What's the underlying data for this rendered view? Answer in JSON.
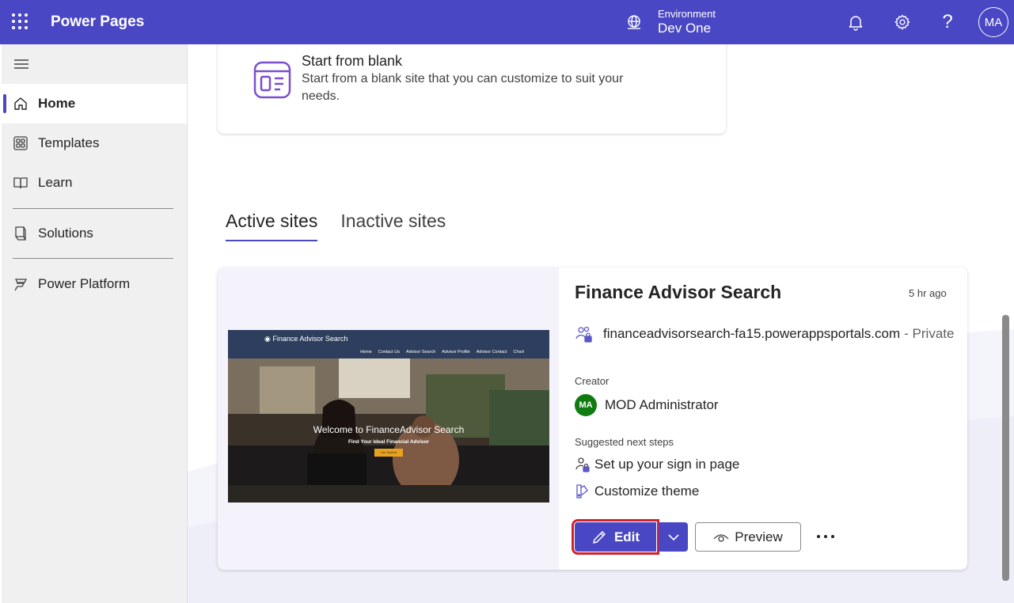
{
  "header": {
    "app_name": "Power Pages",
    "environment_label": "Environment",
    "environment_name": "Dev One",
    "help_glyph": "?",
    "user_initials": "MA",
    "icons": [
      "waffle-icon",
      "globe-icon",
      "bell-icon",
      "gear-icon",
      "help-icon"
    ]
  },
  "sidebar": {
    "items": [
      {
        "label": "Home",
        "icon": "home-icon",
        "active": true
      },
      {
        "label": "Templates",
        "icon": "templates-icon",
        "active": false
      },
      {
        "label": "Learn",
        "icon": "book-icon",
        "active": false
      },
      {
        "label": "Solutions",
        "icon": "solutions-icon",
        "active": false
      },
      {
        "label": "Power Platform",
        "icon": "power-platform-icon",
        "active": false
      }
    ]
  },
  "blank_card": {
    "title": "Start from blank",
    "description": "Start from a blank site that you can customize to suit your needs."
  },
  "tabs": [
    {
      "label": "Active sites",
      "active": true
    },
    {
      "label": "Inactive sites",
      "active": false
    }
  ],
  "site": {
    "name": "Finance Advisor Search",
    "time": "5 hr ago",
    "url": "financeadvisorsearch-fa15.powerappsportals.com",
    "visibility": "- Private",
    "creator_label": "Creator",
    "creator_initials": "MA",
    "creator_name": "MOD Administrator",
    "next_steps_label": "Suggested next steps",
    "steps": [
      "Set up your sign in page",
      "Customize theme"
    ],
    "thumbnail": {
      "title": "Finance Advisor Search",
      "nav": [
        "Home",
        "Contact Us",
        "Advisor Search",
        "Advisor Profile",
        "Advisor Contact",
        "Chart"
      ],
      "welcome": "Welcome to FinanceAdvisor Search",
      "subtitle": "Find Your Ideal Financial Advisor",
      "cta": "Get Started"
    }
  },
  "actions": {
    "edit": "Edit",
    "preview": "Preview"
  },
  "colors": {
    "brand": "#4a47c4",
    "highlight": "#d2222d",
    "creator_avatar": "#107c10"
  }
}
